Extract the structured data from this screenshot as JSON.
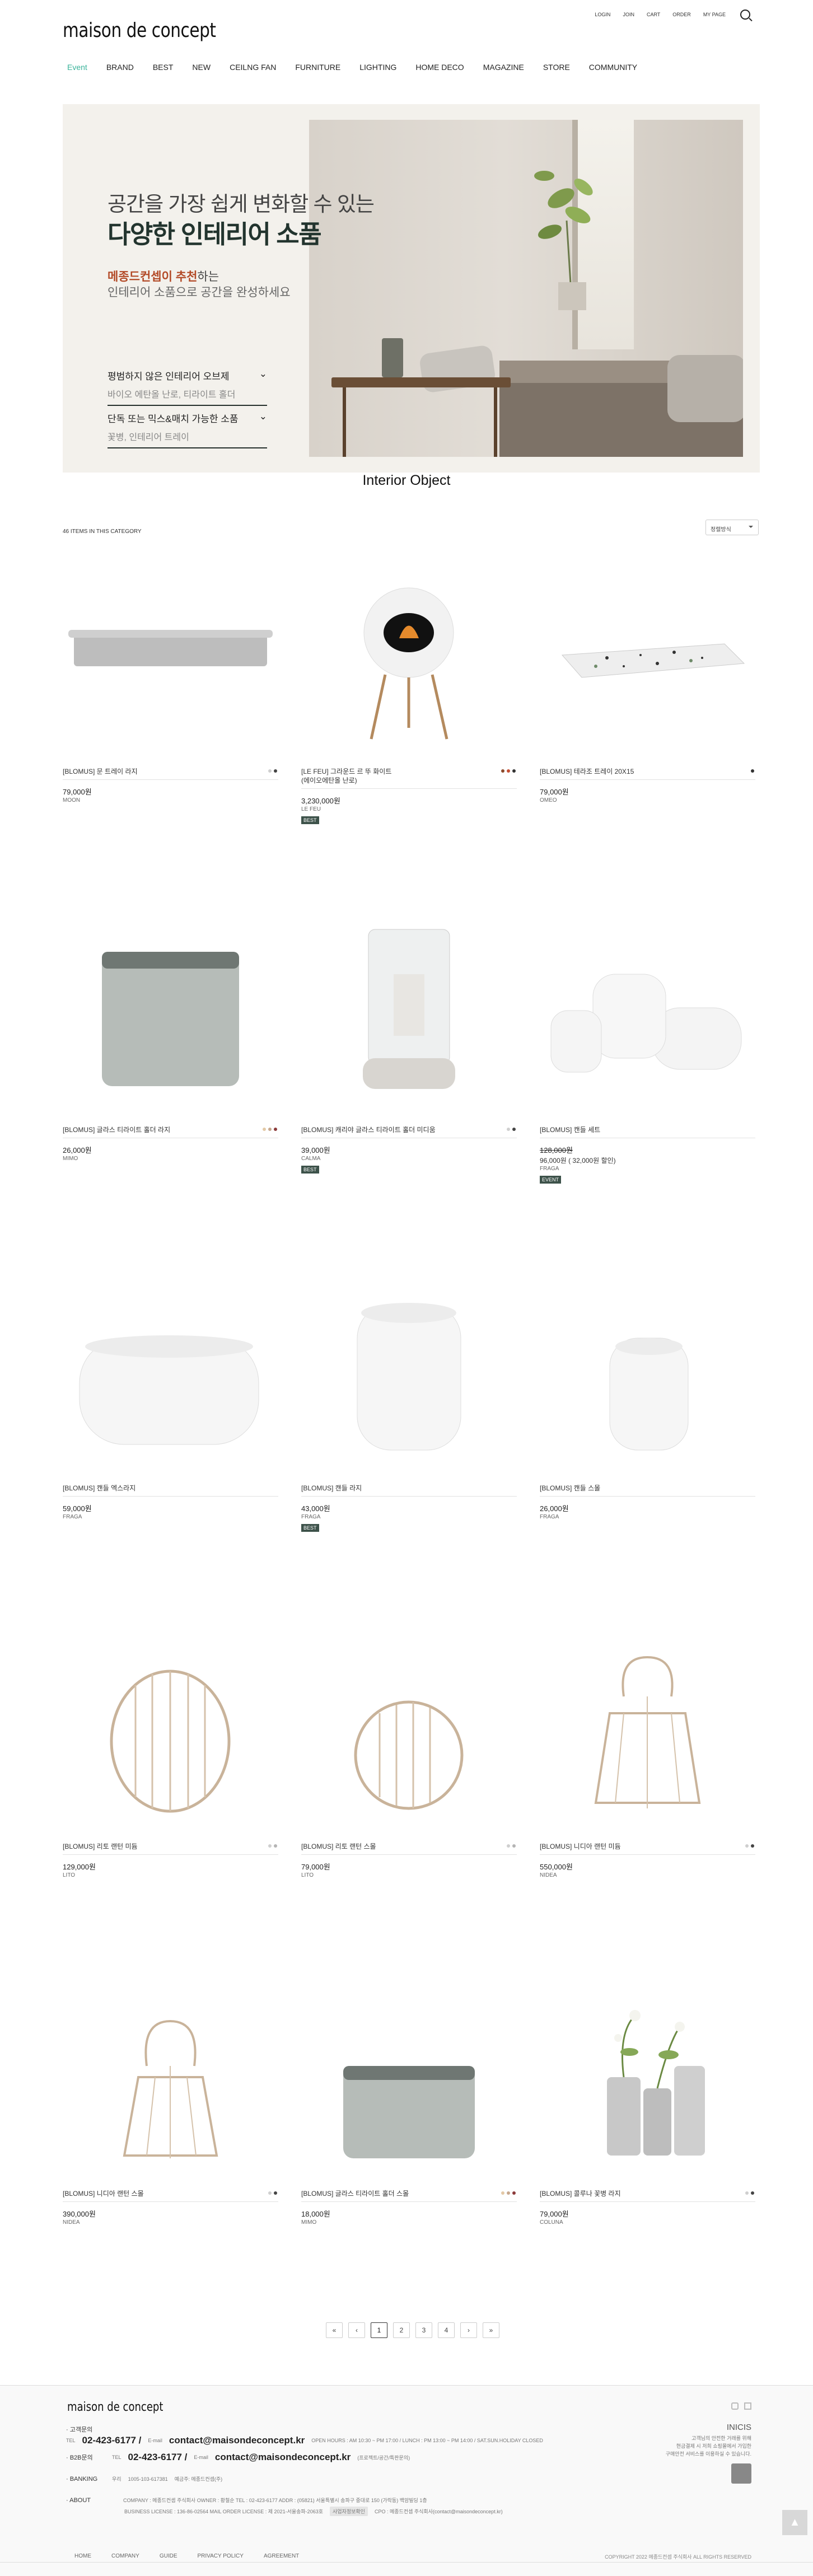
{
  "header": {
    "logo": "maison de concept",
    "util": [
      "LOGIN",
      "JOIN",
      "CART",
      "ORDER",
      "MY PAGE"
    ],
    "nav": [
      "Event",
      "BRAND",
      "BEST",
      "NEW",
      "CEILNG FAN",
      "FURNITURE",
      "LIGHTING",
      "HOME DECO",
      "MAGAZINE",
      "STORE",
      "COMMUNITY"
    ]
  },
  "banner": {
    "line1": "공간을 가장 쉽게 변화할 수 있는",
    "line2": "다양한 인테리어 소품",
    "line3_bold": "메종드컨셉이 추천",
    "line3_rest": "하는",
    "line4": "인테리어 소품으로 공간을 완성하세요",
    "link1_title": "평범하지 않은 인테리어 오브제",
    "link1_sub": "바이오 에탄올 난로, 티라이트 홀더",
    "link2_title": "단독 또는 믹스&매치 가능한 소품",
    "link2_sub": "꽃병, 인테리어 트레이"
  },
  "section_title": "Interior Object",
  "item_count": "46 ITEMS IN THIS CATEGORY",
  "sort_label": "정렬방식",
  "colors": {
    "accent": "#39b39a",
    "badge": "#3d524a",
    "banner_bg": "#f3f1ec"
  },
  "products": [
    {
      "name": "[BLOMUS] 문 트레이 라지",
      "price": "79,000원",
      "brand": "MOON",
      "dots": [
        "#cfcfcf",
        "#444"
      ]
    },
    {
      "name": "[LE FEU] 그라운드 르 뚜 화이트\n(에이오에탄올 난로)",
      "price": "3,230,000원",
      "brand": "LE FEU",
      "badge": "BEST",
      "dots": [
        "#8c4a2c",
        "#c54d32",
        "#333"
      ]
    },
    {
      "name": "[BLOMUS] 테라조 트레이 20X15",
      "price": "79,000원",
      "brand": "OMEO",
      "dots": [
        "#333"
      ]
    },
    {
      "name": "[BLOMUS] 글라스 티라이트 홀더 라지",
      "price": "26,000원",
      "brand": "MIMO",
      "dots": [
        "#e3c9a6",
        "#c7a88e",
        "#8c3b3b"
      ]
    },
    {
      "name": "[BLOMUS] 캐리야 글라스 티라이트 홀더 미디움",
      "price": "39,000원",
      "brand": "CALMA",
      "badge": "BEST",
      "dots": [
        "#cfcfcf",
        "#444"
      ]
    },
    {
      "name": "[BLOMUS] 캔들 세트",
      "price": "128,000원",
      "price_strike": true,
      "sub": "96,000원 ( 32,000원 할인)",
      "brand": "FRAGA",
      "badge": "EVENT",
      "dots": []
    },
    {
      "name": "[BLOMUS] 캔들 엑스라지",
      "price": "59,000원",
      "brand": "FRAGA",
      "dots": []
    },
    {
      "name": "[BLOMUS] 캔들 라지",
      "price": "43,000원",
      "brand": "FRAGA",
      "badge": "BEST",
      "dots": []
    },
    {
      "name": "[BLOMUS] 캔들 스몰",
      "price": "26,000원",
      "brand": "FRAGA",
      "dots": []
    },
    {
      "name": "[BLOMUS] 리토 랜턴 미듐",
      "price": "129,000원",
      "brand": "LITO",
      "dots": [
        "#cfcfcf",
        "#b4b4b4"
      ]
    },
    {
      "name": "[BLOMUS] 리토 랜턴 스몰",
      "price": "79,000원",
      "brand": "LITO",
      "dots": [
        "#cfcfcf",
        "#b4b4b4"
      ]
    },
    {
      "name": "[BLOMUS] 니디아 랜턴 미듐",
      "price": "550,000원",
      "brand": "NIDEA",
      "dots": [
        "#cfcfcf",
        "#444"
      ]
    },
    {
      "name": "[BLOMUS] 니디아 랜턴 스몰",
      "price": "390,000원",
      "brand": "NIDEA",
      "dots": [
        "#cfcfcf",
        "#444"
      ]
    },
    {
      "name": "[BLOMUS] 글라스 티라이트 홀더 스몰",
      "price": "18,000원",
      "brand": "MIMO",
      "dots": [
        "#e3c9a6",
        "#c7a88e",
        "#8c3b3b"
      ]
    },
    {
      "name": "[BLOMUS] 콜루나 꽃병 라지",
      "price": "79,000원",
      "brand": "COLUNA",
      "dots": [
        "#cfcfcf",
        "#444"
      ]
    }
  ],
  "pager": [
    "«",
    "‹",
    "1",
    "2",
    "3",
    "4",
    "›",
    "»"
  ],
  "footer": {
    "logo": "maison de concept",
    "cs_label": "· 고객문의",
    "tel_prefix": "TEL",
    "tel": "02-423-6177 /",
    "email_prefix": "E-mail",
    "email": "contact@maisondeconcept.kr",
    "hours": "OPEN HOURS : AM 10:30 ~ PM 17:00 / LUNCH : PM 13:00 ~ PM 14:00 / SAT.SUN.HOLIDAY CLOSED",
    "b2b_label": "· B2B문의",
    "b2b_tel": "02-423-6177 /",
    "b2b_email": "contact@maisondeconcept.kr",
    "b2b_note": "(프로젝트/공간/특판문의)",
    "bank_label": "· BANKING",
    "bank_name": "우리",
    "bank_no": "1005-103-617381",
    "bank_holder": "예금주: 메종드컨셉(주)",
    "about_label": "· ABOUT",
    "about1": "COMPANY : 메종드컨셉 주식회사     OWNER : 황철순     TEL : 02-423-6177     ADDR : (05821) 서울특별시 송파구 중대로 150 (가락동) 백암빌딩 1층",
    "about2": "BUSINESS LICENSE : 136-86-02564     MAIL ORDER LICENSE : 제 2021-서울송파-2063호",
    "about2_badge": "사업자정보확인",
    "about3": "CPO : 메종드컨셉 주식회사(contact@maisondeconcept.kr)",
    "inicis": "INICIS",
    "inicis_text": "고객님의 안전한 거래를 위해\n현금결제 시 저희 쇼핑몰에서 가입한\n구매안전 서비스를 이용하실 수 있습니다.",
    "links": [
      "HOME",
      "COMPANY",
      "GUIDE",
      "PRIVACY POLICY",
      "AGREEMENT"
    ],
    "copyright": "COPYRIGHT 2022 메종드컨셉 주식회사 ALL RIGHTS RESERVED"
  },
  "top_button": "▲"
}
